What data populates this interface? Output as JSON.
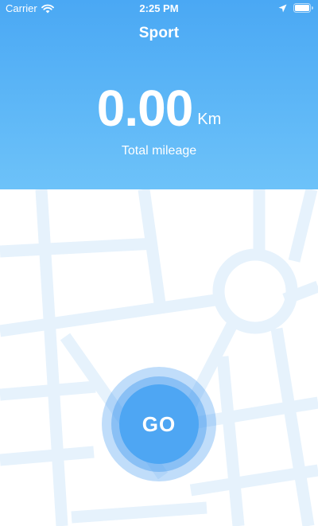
{
  "status_bar": {
    "carrier": "Carrier",
    "time": "2:25 PM",
    "icons": [
      "wifi-icon",
      "location-arrow-icon",
      "battery-icon"
    ]
  },
  "header": {
    "title": "Sport",
    "mileage_value": "0.00",
    "mileage_unit": "Km",
    "mileage_label": "Total mileage",
    "gradient_colors": [
      "#4aa8f4",
      "#6dc2f9"
    ]
  },
  "map": {
    "road_color": "#e6f2fc",
    "background_color": "#ffffff"
  },
  "go_button": {
    "label": "GO",
    "color": "#4ea6f3"
  }
}
